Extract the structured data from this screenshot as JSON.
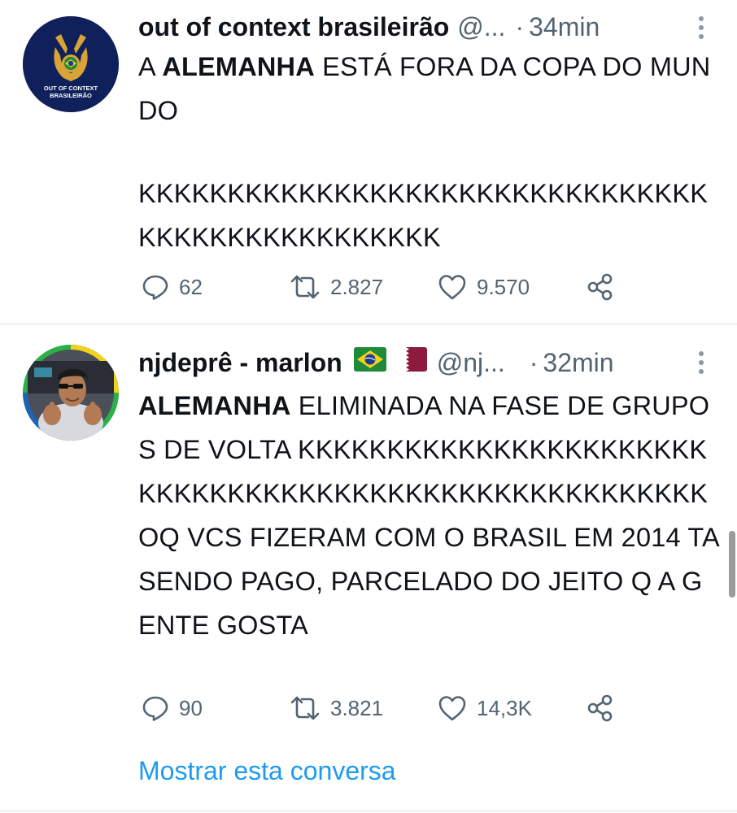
{
  "tweets": [
    {
      "display_name": "out of context brasileirão",
      "handle": "@...",
      "separator": "·",
      "time": "34min",
      "avatar_text_line1": "OUT OF CONTEXT",
      "avatar_text_line2": "BRASILEIRÃO",
      "text_prefix": "A ",
      "text_bold": "ALEMANHA",
      "text_rest": " ESTÁ FORA DA COPA DO MUNDO",
      "text_laugh": "KKKKKKKKKKKKKKKKKKKKKKKKKKKKKKKKKKKKKKKKKKKKKKKKK",
      "replies": "62",
      "retweets": "2.827",
      "likes": "9.570"
    },
    {
      "display_name": "njdeprê - marlon",
      "handle": "@nj...",
      "separator": "·",
      "time": "32min",
      "text_bold": "ALEMANHA",
      "text_rest": " ELIMINADA NA FASE DE GRUPOS DE VOLTA KKKKKKKKKKKKKKKKKKKKKKKKKKKKKKKKKKKKKKKKKKKKKKKKKKKKKKK OQ VCS FIZERAM COM O BRASIL EM 2014 TA SENDO PAGO, PARCELADO DO JEITO Q A GENTE GOSTA",
      "replies": "90",
      "retweets": "3.821",
      "likes": "14,3K",
      "show_thread": "Mostrar esta conversa"
    }
  ],
  "icons": {
    "reply": "reply-icon",
    "retweet": "retweet-icon",
    "like": "like-icon",
    "share": "share-icon",
    "more": "more-vertical-icon",
    "flag1": "brazil-flag-icon",
    "flag2": "qatar-flag-icon"
  },
  "colors": {
    "text": "#0f1419",
    "secondary": "#536471",
    "link": "#1d9bf0",
    "avatar1_bg": "#10205a",
    "avatar1_trophy": "#d7a437"
  }
}
